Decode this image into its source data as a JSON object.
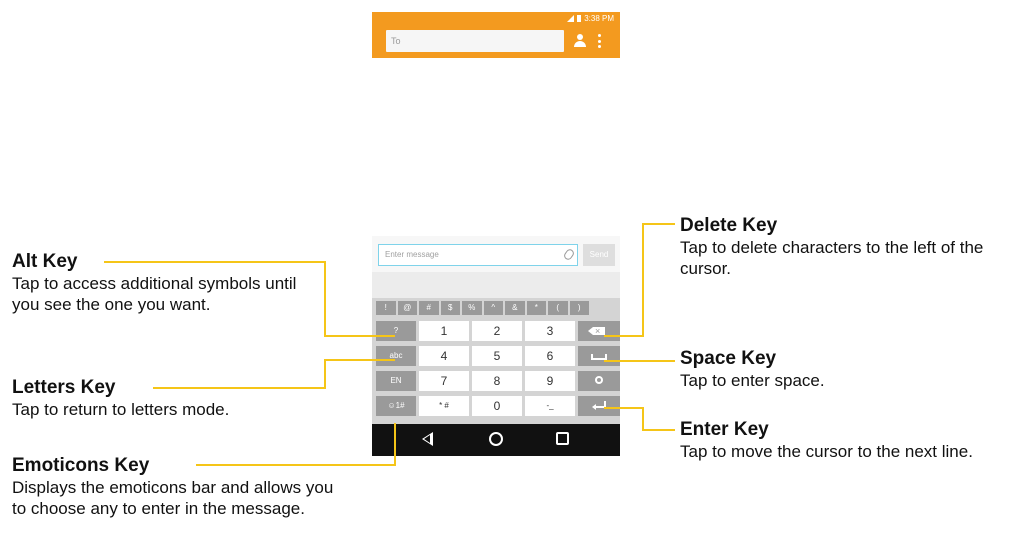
{
  "header": {
    "time": "3:38 PM",
    "to_placeholder": "To",
    "accent_color": "#f39a1f"
  },
  "compose": {
    "placeholder": "Enter message",
    "send_label": "Send"
  },
  "keyboard": {
    "symbols": [
      "!",
      "@",
      "#",
      "$",
      "%",
      "^",
      "&",
      "*",
      "(",
      ")"
    ],
    "rows": [
      {
        "left": "?",
        "digits": [
          "1",
          "2",
          "3"
        ],
        "right_icon": "delete-icon"
      },
      {
        "left": "abc",
        "digits": [
          "4",
          "5",
          "6"
        ],
        "right_icon": "space-icon"
      },
      {
        "left": "EN",
        "digits": [
          "7",
          "8",
          "9"
        ],
        "right_icon": "settings-icon"
      },
      {
        "left": "☺1#",
        "digits": [
          "* #",
          "0",
          "-_"
        ],
        "right_icon": "enter-icon"
      }
    ]
  },
  "navbar": {
    "icons": [
      "back-icon",
      "home-icon",
      "recents-icon"
    ]
  },
  "callouts": {
    "alt": {
      "title": "Alt Key",
      "desc": "Tap to access additional symbols until you see the one you want."
    },
    "letters": {
      "title": "Letters Key",
      "desc": "Tap to return to letters mode."
    },
    "emoticons": {
      "title": "Emoticons Key",
      "desc": "Displays the emoticons bar and allows you to choose any to enter in the message."
    },
    "delete": {
      "title": "Delete Key",
      "desc": "Tap to delete characters to the left of the cursor."
    },
    "space": {
      "title": "Space Key",
      "desc": "Tap to enter space."
    },
    "enter": {
      "title": "Enter Key",
      "desc": "Tap to move the cursor to the next line."
    }
  },
  "line_color": "#f5c518"
}
